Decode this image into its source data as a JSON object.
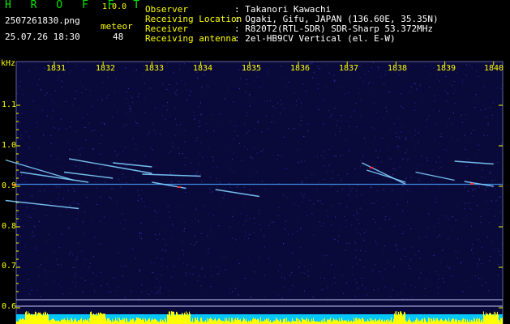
{
  "app": {
    "name": "H R O F F T",
    "version": "1.0.0"
  },
  "file": {
    "name": "2507261830.png",
    "datetime": "25.07.26 18:30"
  },
  "meteor": {
    "label": "meteor",
    "count": "48"
  },
  "meta": [
    {
      "key": "Observer",
      "value": ": Takanori Kawachi"
    },
    {
      "key": "Receiving Location",
      "value": ": Ogaki, Gifu, JAPAN (136.60E, 35.35N)"
    },
    {
      "key": "Receiver",
      "value": ": R820T2(RTL-SDR) SDR-Sharp 53.372MHz"
    },
    {
      "key": "Receiving antenna",
      "value": ": 2el-HB9CV Vertical (el. E-W)"
    }
  ],
  "axis": {
    "unit": "kHz",
    "y_ticks": [
      "1.1",
      "1.0",
      "0.9",
      "0.8",
      "0.7",
      "0.6"
    ],
    "x_ticks": [
      "1831",
      "1832",
      "1833",
      "1834",
      "1835",
      "1836",
      "1837",
      "1838",
      "1839",
      "1840"
    ]
  },
  "colors": {
    "background": "#000000",
    "plot_bg": "#0a0a3a",
    "carrier": "#4aa0ff",
    "meteor_trail": "#7fd0ff",
    "meteor_head": "#ff3030",
    "title_green": "#00e600",
    "label_yellow": "#ffff00",
    "baseline_cyan": "#00c8ff"
  },
  "spectrogram": {
    "carrier_khz": 0.905,
    "trails": [
      {
        "t0": "1830.0",
        "t1": "1831.4",
        "f0": 0.965,
        "f1": 0.915
      },
      {
        "t0": "1830.3",
        "t1": "1831.7",
        "f0": 0.935,
        "f1": 0.91
      },
      {
        "t0": "1830.0",
        "t1": "1831.5",
        "f0": 0.865,
        "f1": 0.845
      },
      {
        "t0": "1831.2",
        "t1": "1832.2",
        "f0": 0.935,
        "f1": 0.92
      },
      {
        "t0": "1831.3",
        "t1": "1833.0",
        "f0": 0.968,
        "f1": 0.932
      },
      {
        "t0": "1832.2",
        "t1": "1833.0",
        "f0": 0.958,
        "f1": 0.948
      },
      {
        "t0": "1832.8",
        "t1": "1834.0",
        "f0": 0.93,
        "f1": 0.925
      },
      {
        "t0": "1833.0",
        "t1": "1833.7",
        "f0": 0.91,
        "f1": 0.895
      },
      {
        "t0": "1834.3",
        "t1": "1835.2",
        "f0": 0.892,
        "f1": 0.875
      },
      {
        "t0": "1837.3",
        "t1": "1838.2",
        "f0": 0.958,
        "f1": 0.905
      },
      {
        "t0": "1837.4",
        "t1": "1838.2",
        "f0": 0.94,
        "f1": 0.91
      },
      {
        "t0": "1838.4",
        "t1": "1839.2",
        "f0": 0.935,
        "f1": 0.915
      },
      {
        "t0": "1839.2",
        "t1": "1840.0",
        "f0": 0.962,
        "f1": 0.955
      },
      {
        "t0": "1839.4",
        "t1": "1840.0",
        "f0": 0.912,
        "f1": 0.9
      }
    ]
  }
}
